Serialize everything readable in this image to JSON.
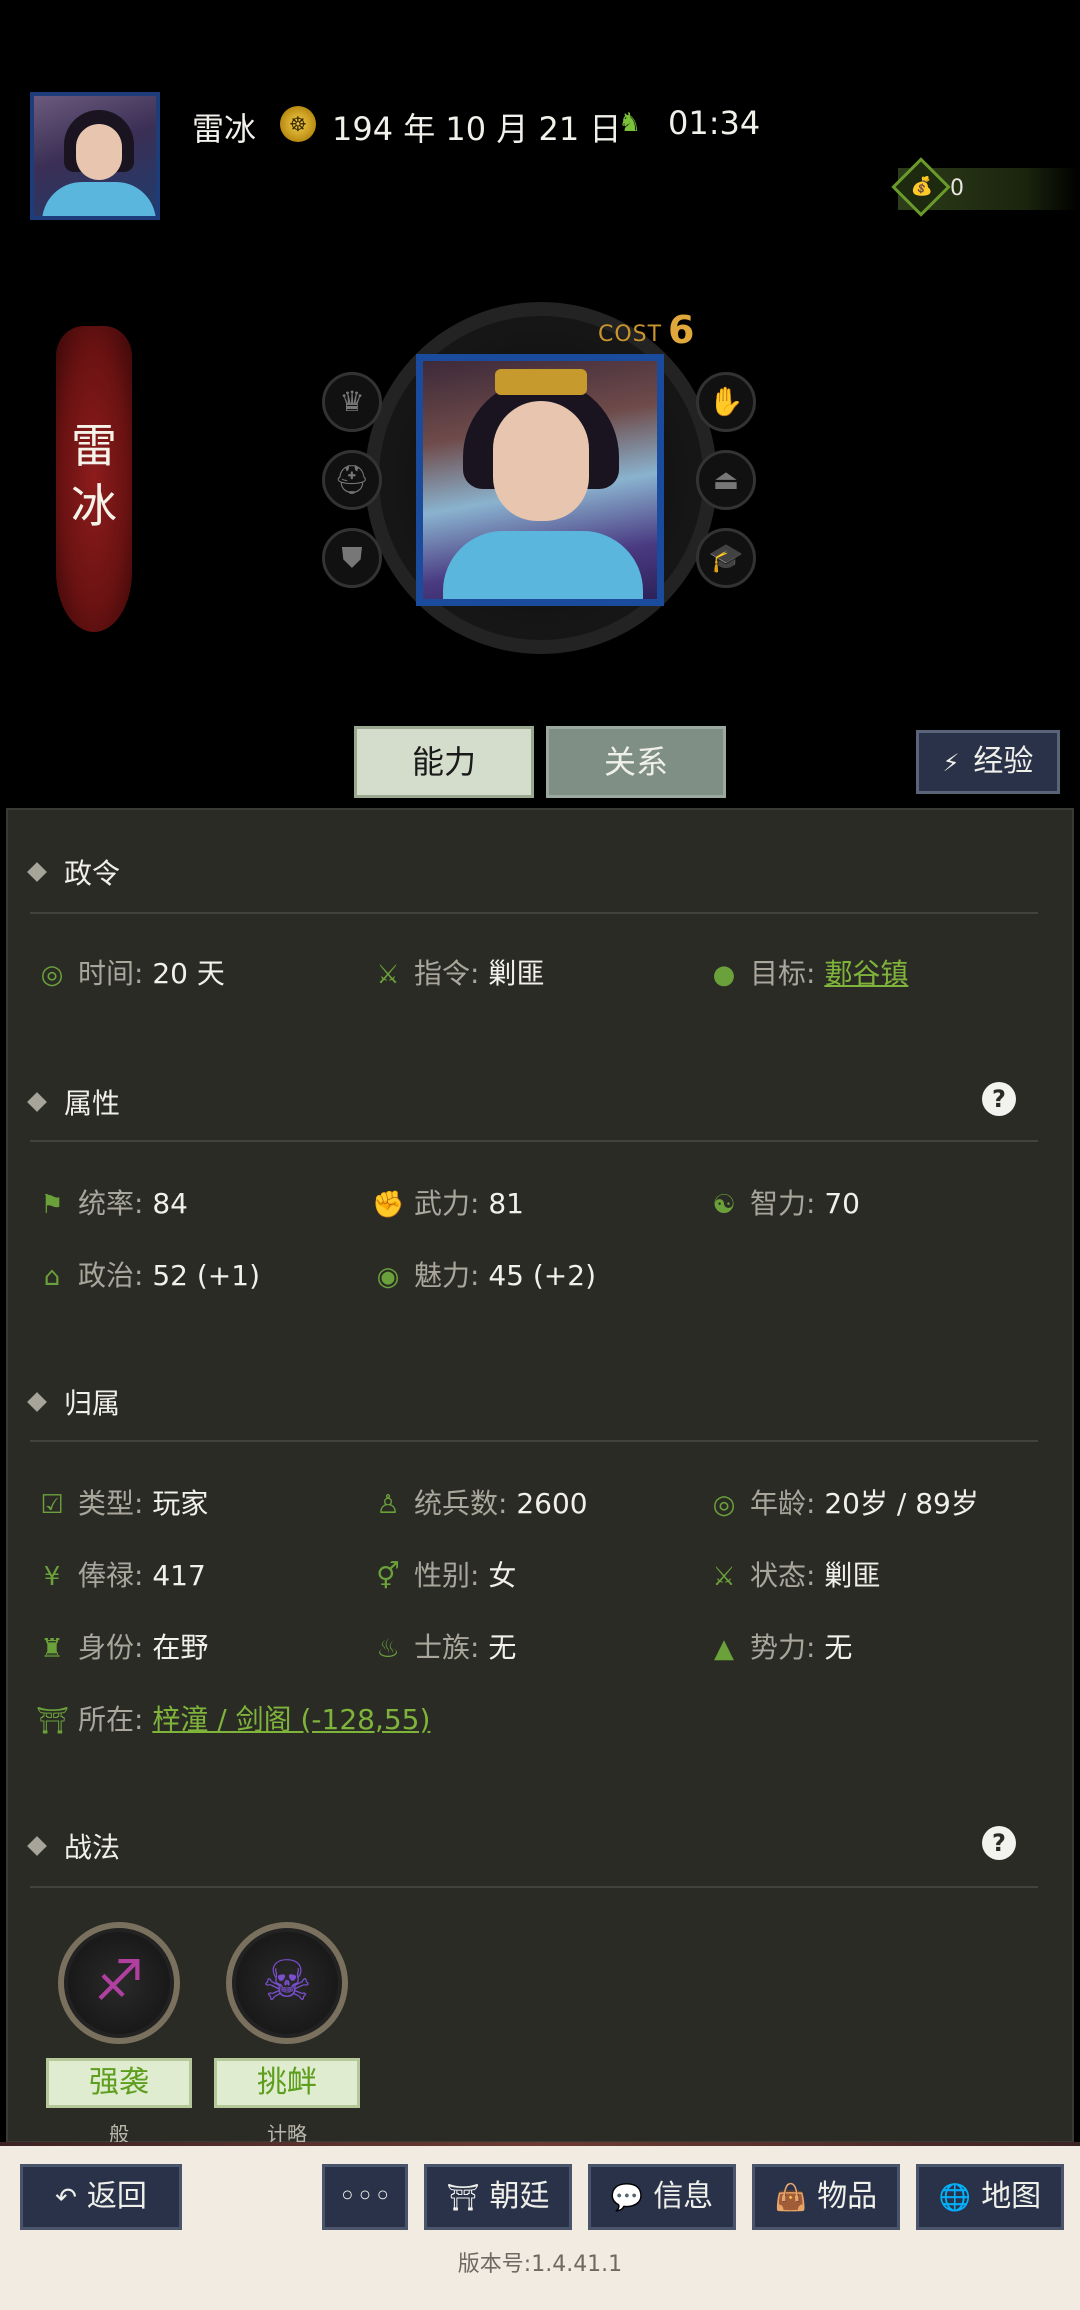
{
  "header": {
    "player_name": "雷冰",
    "date": "194 年 10 月 21 日",
    "time": "01:34",
    "gold": "0"
  },
  "hero": {
    "name_chars": [
      "雷",
      "冰"
    ],
    "cost_label": "COST",
    "cost_value": "6"
  },
  "tabs": {
    "ability": "能力",
    "relation": "关系",
    "experience": "经验"
  },
  "sections": {
    "decree": {
      "title": "政令",
      "time_key": "时间:",
      "time_val": "20 天",
      "order_key": "指令:",
      "order_val": "剿匪",
      "target_key": "目标:",
      "target_val": "郪谷镇"
    },
    "attributes": {
      "title": "属性",
      "lead_key": "统率:",
      "lead_val": "84",
      "war_key": "武力:",
      "war_val": "81",
      "int_key": "智力:",
      "int_val": "70",
      "pol_key": "政治:",
      "pol_val": "52 (+1)",
      "cha_key": "魅力:",
      "cha_val": "45 (+2)"
    },
    "belonging": {
      "title": "归属",
      "type_key": "类型:",
      "type_val": "玩家",
      "troops_key": "统兵数:",
      "troops_val": "2600",
      "age_key": "年龄:",
      "age_val": "20岁 / 89岁",
      "salary_key": "俸禄:",
      "salary_val": "417",
      "gender_key": "性别:",
      "gender_val": "女",
      "status_key": "状态:",
      "status_val": "剿匪",
      "identity_key": "身份:",
      "identity_val": "在野",
      "clan_key": "士族:",
      "clan_val": "无",
      "faction_key": "势力:",
      "faction_val": "无",
      "location_key": "所在:",
      "location_val": "梓潼 / 剑阁 (-128,55)"
    },
    "tactics": {
      "title": "战法",
      "skills": [
        {
          "name": "强袭",
          "type": "般"
        },
        {
          "name": "挑衅",
          "type": "计略"
        }
      ]
    }
  },
  "help_symbol": "?",
  "nav": {
    "back": "返回",
    "more": "◦◦◦",
    "court": "朝廷",
    "info": "信息",
    "items": "物品",
    "map": "地图"
  },
  "version": "版本号:1.4.41.1",
  "colors": {
    "accent_green": "#7fb43a",
    "panel_bg": "#2b2b26",
    "portrait_border": "#1a4b9c",
    "banner_red": "#8e1c1c"
  }
}
